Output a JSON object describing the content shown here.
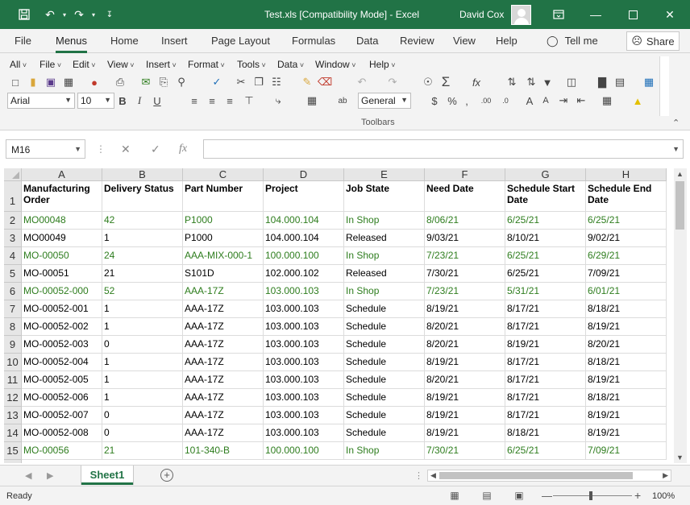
{
  "window": {
    "title": "Test.xls  [Compatibility Mode]  -  Excel",
    "user": "David Cox",
    "icons": [
      "save-icon",
      "undo-icon",
      "redo-icon",
      "customize-icon",
      "ribbon-display-icon",
      "minimize-icon",
      "maximize-icon",
      "close-icon"
    ]
  },
  "ribbon_tabs": [
    "File",
    "Menus",
    "Home",
    "Insert",
    "Page Layout",
    "Formulas",
    "Data",
    "Review",
    "View",
    "Help"
  ],
  "active_tab": "Menus",
  "tell_me": "Tell me",
  "share_label": "Share",
  "menus": [
    "All",
    "File",
    "Edit",
    "View",
    "Insert",
    "Format",
    "Tools",
    "Data",
    "Window",
    "Help"
  ],
  "toolbar": {
    "font_name": "Arial",
    "font_size": "10",
    "number_format": "General",
    "bold": "B",
    "italic": "I",
    "underline": "U",
    "group_label": "Toolbars"
  },
  "formula_bar": {
    "name_box": "M16",
    "formula": ""
  },
  "grid": {
    "columns": [
      "A",
      "B",
      "C",
      "D",
      "E",
      "F",
      "G",
      "H"
    ],
    "row_numbers": [
      "1",
      "2",
      "3",
      "4",
      "5",
      "6",
      "7",
      "8",
      "9",
      "10",
      "11",
      "12",
      "13",
      "14",
      "15"
    ],
    "header_row": [
      "Manufacturing Order",
      "Delivery Status",
      "Part Number",
      "Project",
      "Job State",
      "Need Date",
      "Schedule Start Date",
      "Schedule End Date"
    ],
    "rows": [
      {
        "cells": [
          "MO00048",
          "42",
          "P1000",
          "104.000.104",
          "In Shop",
          "8/06/21",
          "6/25/21",
          "6/25/21"
        ],
        "green": true
      },
      {
        "cells": [
          "MO00049",
          "1",
          "P1000",
          "104.000.104",
          "Released",
          "9/03/21",
          "8/10/21",
          "9/02/21"
        ],
        "green": false
      },
      {
        "cells": [
          "MO-00050",
          "24",
          "AAA-MIX-000-1",
          "100.000.100",
          "In Shop",
          "7/23/21",
          "6/25/21",
          "6/29/21"
        ],
        "green": true
      },
      {
        "cells": [
          "MO-00051",
          "21",
          "S101D",
          "102.000.102",
          "Released",
          "7/30/21",
          "6/25/21",
          "7/09/21"
        ],
        "green": false
      },
      {
        "cells": [
          "MO-00052-000",
          "52",
          "AAA-17Z",
          "103.000.103",
          "In Shop",
          "7/23/21",
          "5/31/21",
          "6/01/21"
        ],
        "green": true
      },
      {
        "cells": [
          "MO-00052-001",
          "1",
          "AAA-17Z",
          "103.000.103",
          "Schedule",
          "8/19/21",
          "8/17/21",
          "8/18/21"
        ],
        "green": false
      },
      {
        "cells": [
          "MO-00052-002",
          "1",
          "AAA-17Z",
          "103.000.103",
          "Schedule",
          "8/20/21",
          "8/17/21",
          "8/19/21"
        ],
        "green": false
      },
      {
        "cells": [
          "MO-00052-003",
          "0",
          "AAA-17Z",
          "103.000.103",
          "Schedule",
          "8/20/21",
          "8/19/21",
          "8/20/21"
        ],
        "green": false
      },
      {
        "cells": [
          "MO-00052-004",
          "1",
          "AAA-17Z",
          "103.000.103",
          "Schedule",
          "8/19/21",
          "8/17/21",
          "8/18/21"
        ],
        "green": false
      },
      {
        "cells": [
          "MO-00052-005",
          "1",
          "AAA-17Z",
          "103.000.103",
          "Schedule",
          "8/20/21",
          "8/17/21",
          "8/19/21"
        ],
        "green": false
      },
      {
        "cells": [
          "MO-00052-006",
          "1",
          "AAA-17Z",
          "103.000.103",
          "Schedule",
          "8/19/21",
          "8/17/21",
          "8/18/21"
        ],
        "green": false
      },
      {
        "cells": [
          "MO-00052-007",
          "0",
          "AAA-17Z",
          "103.000.103",
          "Schedule",
          "8/19/21",
          "8/17/21",
          "8/19/21"
        ],
        "green": false
      },
      {
        "cells": [
          "MO-00052-008",
          "0",
          "AAA-17Z",
          "103.000.103",
          "Schedule",
          "8/19/21",
          "8/18/21",
          "8/19/21"
        ],
        "green": false
      },
      {
        "cells": [
          "MO-00056",
          "21",
          "101-340-B",
          "100.000.100",
          "In Shop",
          "7/30/21",
          "6/25/21",
          "7/09/21"
        ],
        "green": true
      }
    ]
  },
  "sheet_tabs": [
    "Sheet1"
  ],
  "status": {
    "text": "Ready",
    "zoom": "100%"
  },
  "colors": {
    "excel_green": "#217346",
    "row_green_text": "#2e7d1e"
  }
}
